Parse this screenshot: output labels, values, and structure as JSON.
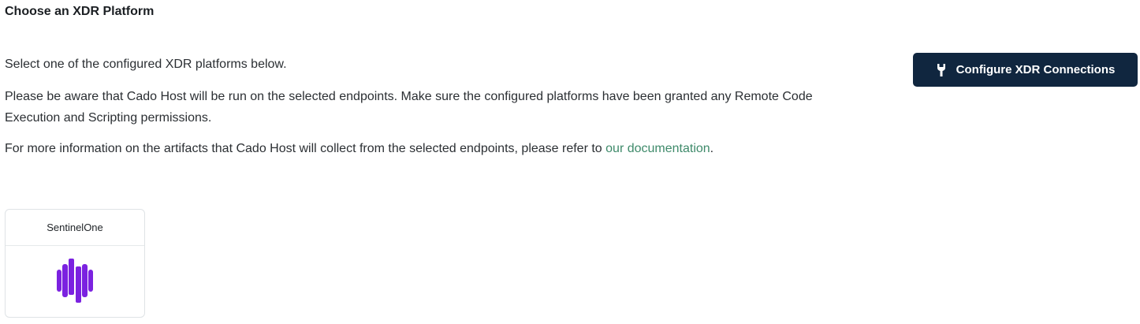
{
  "heading": "Choose an XDR Platform",
  "intro": "Select one of the configured XDR platforms below.",
  "warning": "Please be aware that Cado Host will be run on the selected endpoints. Make sure the configured platforms have been granted any Remote Code Execution and Scripting permissions.",
  "info": {
    "text": "For more information on the artifacts that Cado Host will collect from the selected endpoints, please refer to ",
    "link": "our documentation",
    "after": "."
  },
  "configure_button": {
    "label": "Configure XDR Connections",
    "icon": "wrench-icon"
  },
  "platforms": [
    {
      "name": "SentinelOne",
      "logo": "sentinelone-logo",
      "logo_color": "#7b22e0"
    }
  ],
  "colors": {
    "button_bg": "#10263f",
    "link": "#3e8a6a"
  }
}
